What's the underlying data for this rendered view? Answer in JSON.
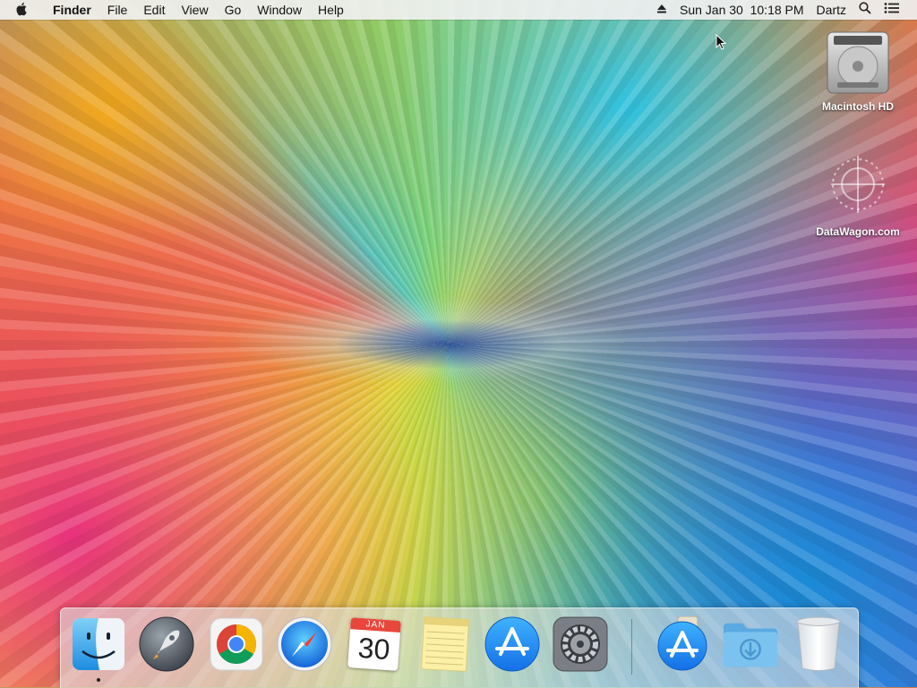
{
  "menubar": {
    "apple_icon": "apple-logo-icon",
    "app_name": "Finder",
    "menus": [
      "File",
      "Edit",
      "View",
      "Go",
      "Window",
      "Help"
    ],
    "eject_icon": "eject-icon",
    "datetime": "Sun Jan 30  10:18 PM",
    "user": "Dartz",
    "search_icon": "spotlight-search-icon",
    "list_icon": "notification-center-icon"
  },
  "desktop": {
    "drive_label": "Macintosh HD",
    "watermark_label": "DataWagon.com"
  },
  "dock": {
    "apps": [
      {
        "name": "Finder",
        "icon": "finder-icon",
        "running": true
      },
      {
        "name": "Launchpad",
        "icon": "launchpad-icon",
        "running": false
      },
      {
        "name": "Google Chrome",
        "icon": "chrome-icon",
        "running": false
      },
      {
        "name": "Safari",
        "icon": "safari-icon",
        "running": false
      },
      {
        "name": "Calendar",
        "icon": "calendar-icon",
        "running": false,
        "month": "JAN",
        "day": "30"
      },
      {
        "name": "Notes",
        "icon": "notes-icon",
        "running": false
      },
      {
        "name": "App Store",
        "icon": "app-store-icon",
        "running": false
      },
      {
        "name": "System Preferences",
        "icon": "system-preferences-icon",
        "running": false
      }
    ],
    "right": [
      {
        "name": "App Store Downloads",
        "icon": "app-store-download-icon"
      },
      {
        "name": "Downloads",
        "icon": "downloads-folder-icon"
      },
      {
        "name": "Trash",
        "icon": "trash-icon"
      }
    ]
  },
  "colors": {
    "menubar_bg": "#f0f0f0",
    "dock_bg": "#e1e1e1",
    "app_store_blue": "#1f8af0",
    "folder_blue": "#6bb6e8"
  }
}
